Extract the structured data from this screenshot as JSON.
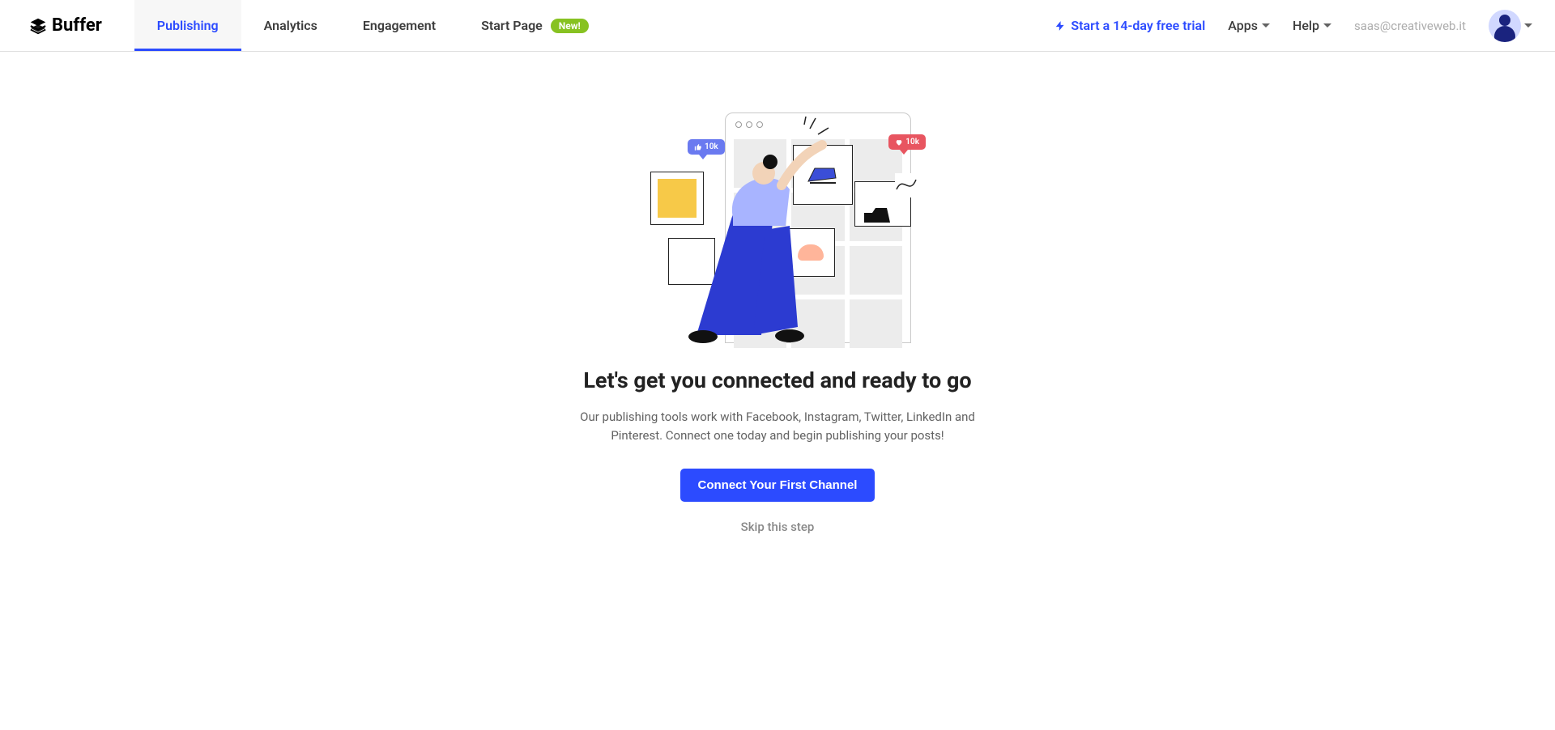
{
  "brand": "Buffer",
  "nav": {
    "tabs": [
      {
        "label": "Publishing",
        "active": true
      },
      {
        "label": "Analytics",
        "active": false
      },
      {
        "label": "Engagement",
        "active": false
      },
      {
        "label": "Start Page",
        "active": false,
        "badge": "New!"
      }
    ],
    "trial_link": "Start a 14-day free trial",
    "apps_label": "Apps",
    "help_label": "Help",
    "email": "saas@creativeweb.it"
  },
  "main": {
    "heading": "Let's get you connected and ready to go",
    "subtext": "Our publishing tools work with Facebook, Instagram, Twitter, LinkedIn and Pinterest. Connect one today and begin publishing your posts!",
    "primary_button": "Connect Your First Channel",
    "skip_link": "Skip this step"
  },
  "illustration": {
    "like_count": "10k",
    "heart_count": "10k"
  }
}
